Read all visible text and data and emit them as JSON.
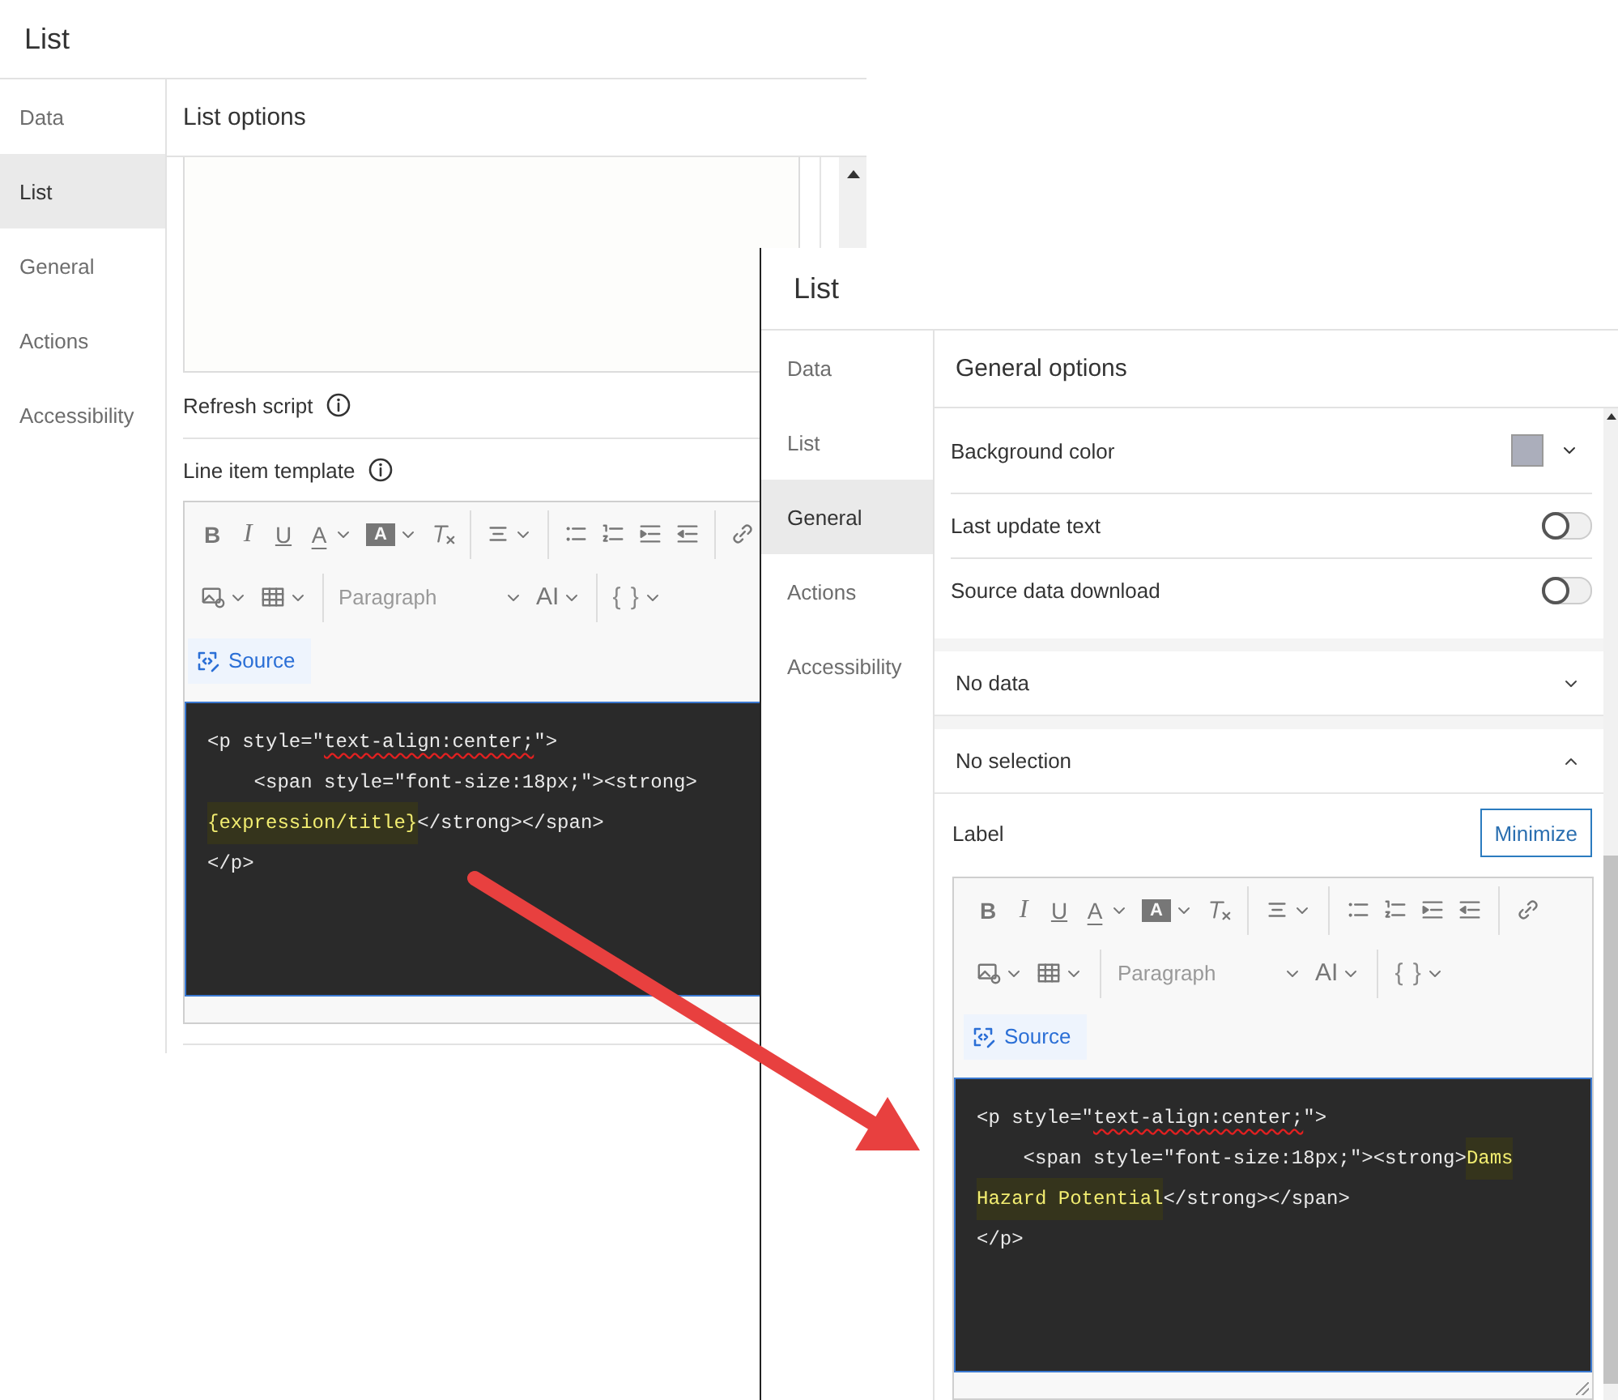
{
  "left_panel": {
    "title": "List",
    "sidebar": [
      {
        "label": "Data",
        "selected": false
      },
      {
        "label": "List",
        "selected": true
      },
      {
        "label": "General",
        "selected": false
      },
      {
        "label": "Actions",
        "selected": false
      },
      {
        "label": "Accessibility",
        "selected": false
      }
    ],
    "header": "List options",
    "refresh_script": {
      "label": "Refresh script"
    },
    "template": {
      "label": "Line item template",
      "editor": {
        "toolbar": [
          [
            {
              "kind": "bold",
              "label": "B",
              "menu": false
            },
            {
              "kind": "italic",
              "label": "I",
              "menu": false
            },
            {
              "kind": "underline",
              "label": "U",
              "menu": false
            },
            {
              "kind": "color",
              "label": "A",
              "menu": true
            },
            {
              "kind": "highlight",
              "label": "A",
              "menu": true
            },
            {
              "kind": "clear",
              "menu": false
            },
            {
              "kind": "separator"
            },
            {
              "kind": "align",
              "menu": true
            },
            {
              "kind": "separator"
            },
            {
              "kind": "bullets",
              "menu": false
            },
            {
              "kind": "numbers",
              "menu": false
            },
            {
              "kind": "indent",
              "menu": false
            },
            {
              "kind": "outdent",
              "menu": false
            },
            {
              "kind": "separator"
            },
            {
              "kind": "link",
              "menu": false
            }
          ],
          [
            {
              "kind": "image",
              "menu": true
            },
            {
              "kind": "table",
              "menu": true
            },
            {
              "kind": "separator"
            },
            {
              "kind": "select",
              "label": "Paragraph",
              "menu": true
            },
            {
              "kind": "size",
              "label": "AI",
              "menu": true
            },
            {
              "kind": "separator"
            },
            {
              "kind": "braces",
              "label": "{ }",
              "menu": true
            }
          ]
        ],
        "source": "Source",
        "code": [
          [
            {
              "text": "<p style=\"",
              "highlight": false,
              "misspelled": false
            },
            {
              "text": "text-align:center;",
              "highlight": false,
              "misspelled": true
            },
            {
              "text": "\">",
              "highlight": false,
              "misspelled": false
            }
          ],
          [
            {
              "text": "    <span style=\"font-size:18px;\"><strong>",
              "highlight": false,
              "misspelled": false
            }
          ],
          [
            {
              "text": "{expression/title}",
              "highlight": true,
              "misspelled": false
            },
            {
              "text": "</strong></span>",
              "highlight": false,
              "misspelled": false
            }
          ],
          [
            {
              "text": "</p>",
              "highlight": false,
              "misspelled": false
            }
          ]
        ]
      }
    }
  },
  "right_panel": {
    "title": "List",
    "sidebar": [
      {
        "label": "Data",
        "selected": false
      },
      {
        "label": "List",
        "selected": false
      },
      {
        "label": "General",
        "selected": true
      },
      {
        "label": "Actions",
        "selected": false
      },
      {
        "label": "Accessibility",
        "selected": false
      }
    ],
    "header": "General options",
    "options": [
      {
        "kind": "color",
        "label": "Background color",
        "color": "#abaebb"
      },
      {
        "kind": "toggle",
        "label": "Last update text",
        "on": false
      },
      {
        "kind": "toggle",
        "label": "Source data download",
        "on": false
      }
    ],
    "sections": [
      {
        "title": "No data",
        "expanded": false
      },
      {
        "title": "No selection",
        "expanded": true,
        "label": "Label",
        "button": "Minimize",
        "editor": {
          "toolbar": [
            [
              {
                "kind": "bold",
                "label": "B",
                "menu": false
              },
              {
                "kind": "italic",
                "label": "I",
                "menu": false
              },
              {
                "kind": "underline",
                "label": "U",
                "menu": false
              },
              {
                "kind": "color",
                "label": "A",
                "menu": true
              },
              {
                "kind": "highlight",
                "label": "A",
                "menu": true
              },
              {
                "kind": "clear",
                "menu": false
              },
              {
                "kind": "separator"
              },
              {
                "kind": "align",
                "menu": true
              },
              {
                "kind": "separator"
              },
              {
                "kind": "bullets",
                "menu": false
              },
              {
                "kind": "numbers",
                "menu": false
              },
              {
                "kind": "indent",
                "menu": false
              },
              {
                "kind": "outdent",
                "menu": false
              },
              {
                "kind": "separator"
              },
              {
                "kind": "link",
                "menu": false
              }
            ],
            [
              {
                "kind": "image",
                "menu": true
              },
              {
                "kind": "table",
                "menu": true
              },
              {
                "kind": "separator"
              },
              {
                "kind": "select",
                "label": "Paragraph",
                "menu": true
              },
              {
                "kind": "size",
                "label": "AI",
                "menu": true
              },
              {
                "kind": "separator"
              },
              {
                "kind": "braces",
                "label": "{ }",
                "menu": true
              }
            ]
          ],
          "source": "Source",
          "code": [
            [
              {
                "text": "<p style=\"",
                "highlight": false,
                "misspelled": false
              },
              {
                "text": "text-align:center;",
                "highlight": false,
                "misspelled": true
              },
              {
                "text": "\">",
                "highlight": false,
                "misspelled": false
              }
            ],
            [
              {
                "text": "    <span style=\"font-size:18px;\"><strong>",
                "highlight": false,
                "misspelled": false
              },
              {
                "text": "Dams",
                "highlight": true,
                "misspelled": false
              }
            ],
            [
              {
                "text": "Hazard Potential",
                "highlight": true,
                "misspelled": false
              },
              {
                "text": "</strong></span>",
                "highlight": false,
                "misspelled": false
              }
            ],
            [
              {
                "text": "</p>",
                "highlight": false,
                "misspelled": false
              }
            ]
          ]
        }
      }
    ]
  }
}
